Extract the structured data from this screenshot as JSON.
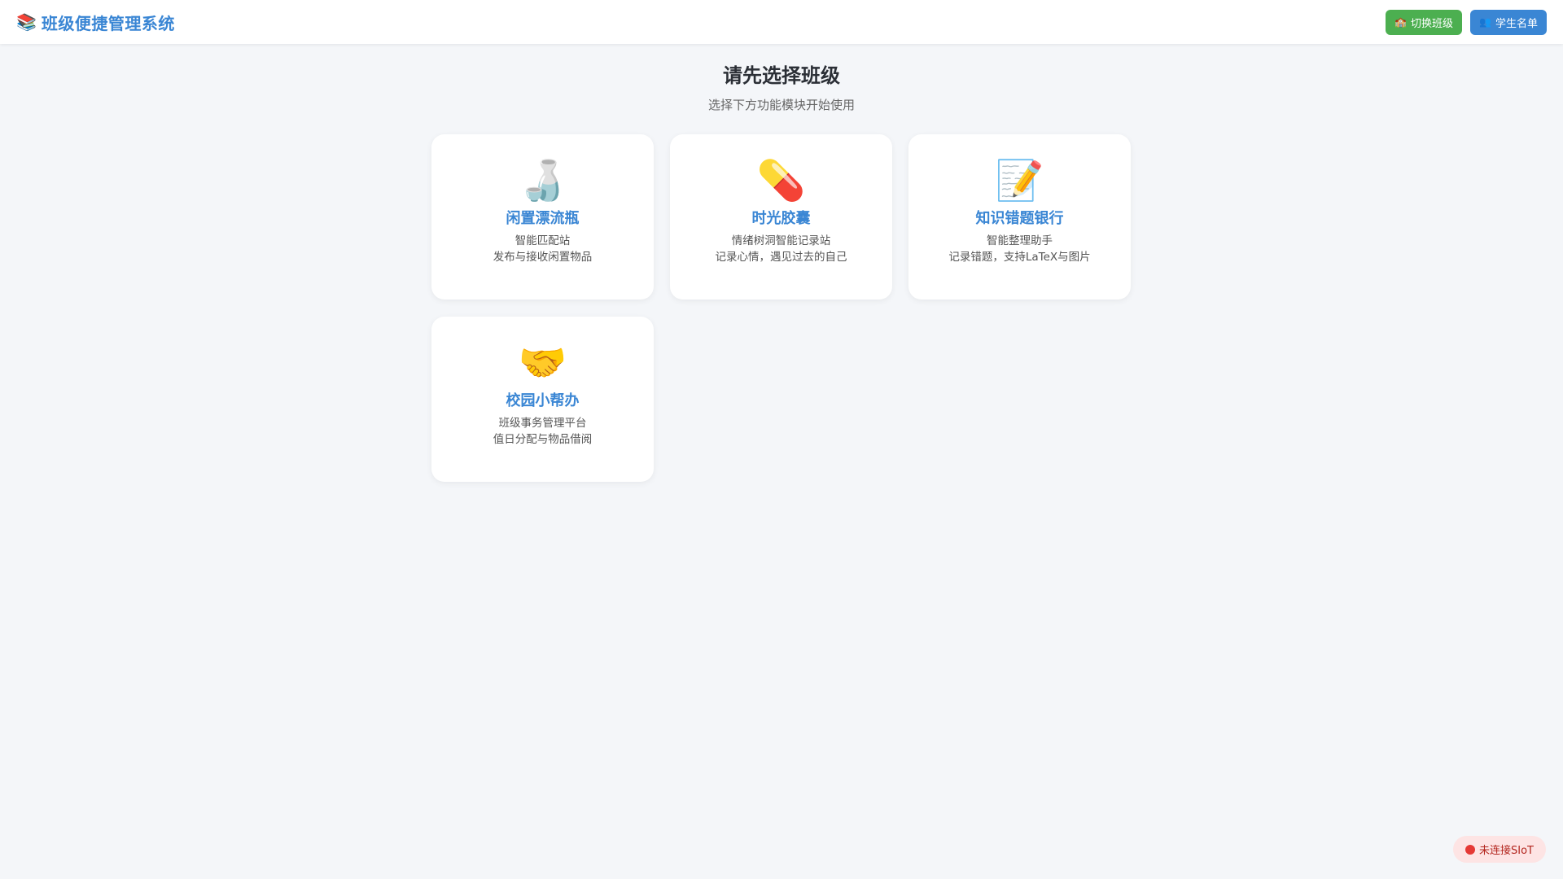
{
  "header": {
    "brand_icon": "📚",
    "brand_title": "班级便捷管理系统",
    "switch_class_icon": "🏫",
    "switch_class_label": "切换班级",
    "roster_icon": "👥",
    "roster_label": "学生名单"
  },
  "main": {
    "title": "请先选择班级",
    "subtitle": "选择下方功能模块开始使用"
  },
  "cards": [
    {
      "icon": "🍶",
      "title": "闲置漂流瓶",
      "line1": "智能匹配站",
      "line2": "发布与接收闲置物品"
    },
    {
      "icon": "💊",
      "title": "时光胶囊",
      "line1": "情绪树洞智能记录站",
      "line2": "记录心情，遇见过去的自己"
    },
    {
      "icon": "📝",
      "title": "知识错题银行",
      "line1": "智能整理助手",
      "line2": "记录错题，支持LaTeX与图片"
    },
    {
      "icon": "🤝",
      "title": "校园小帮办",
      "line1": "班级事务管理平台",
      "line2": "值日分配与物品借阅"
    }
  ],
  "status": {
    "label": "未连接SIoT",
    "dot_color": "#e53935"
  },
  "colors": {
    "accent": "#3a86d4",
    "green": "#4caf50",
    "background": "#f4f6f9"
  }
}
